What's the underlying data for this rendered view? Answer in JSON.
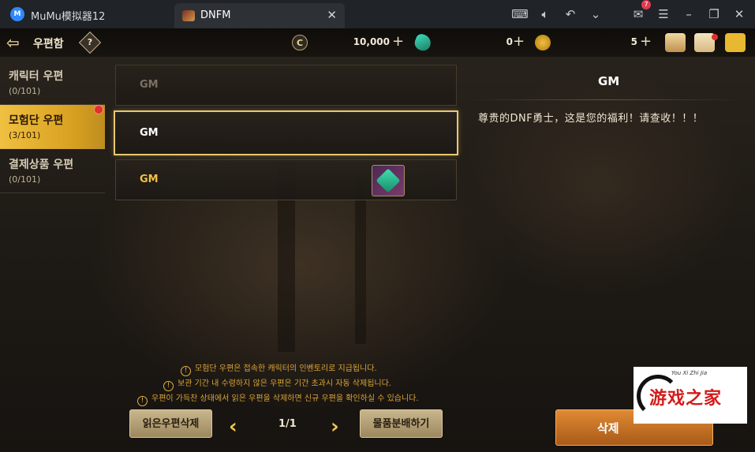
{
  "window": {
    "app_name": "MuMu模拟器12",
    "tab_label": "DNFM",
    "mail_badge_count": "7"
  },
  "topbar": {
    "title": "우편함",
    "help": "?",
    "gold": {
      "symbol": "C",
      "value": "10,000"
    },
    "gem": {
      "value": "0"
    },
    "coin": {
      "value": "5"
    }
  },
  "categories": [
    {
      "label": "캐릭터 우편",
      "count": "(0/101)",
      "active": false
    },
    {
      "label": "모험단 우편",
      "count": "(3/101)",
      "active": true
    },
    {
      "label": "결제상품 우편",
      "count": "(0/101)",
      "active": false
    }
  ],
  "mails": [
    {
      "sender": "GM",
      "state": "read",
      "has_item": false
    },
    {
      "sender": "GM",
      "state": "selected",
      "has_item": false
    },
    {
      "sender": "GM",
      "state": "unread",
      "has_item": true
    }
  ],
  "detail": {
    "sender": "GM",
    "body": "尊贵的DNF勇士，这是您的福利！请查收！！！"
  },
  "notices": [
    "모험단 우편은 접속한 캐릭터의 인벤토리로 지급됩니다.",
    "보관 기간 내 수령하지 않은 우편은 기간 초과시 자동 삭제됩니다.",
    "우편이 가득찬 상태에서 읽은 우편을 삭제하면 신규 우편을 확인하실 수 있습니다."
  ],
  "controls": {
    "delete_read": "읽은우편삭제",
    "page": "1/1",
    "disassemble": "물품분배하기",
    "delete": "삭제"
  },
  "watermark": {
    "small": "You Xi Zhi Jia",
    "text": "游戏之家"
  },
  "colors": {
    "accent": "#f0c040",
    "delete_button": "#d07828",
    "notice": "#d9a438"
  }
}
